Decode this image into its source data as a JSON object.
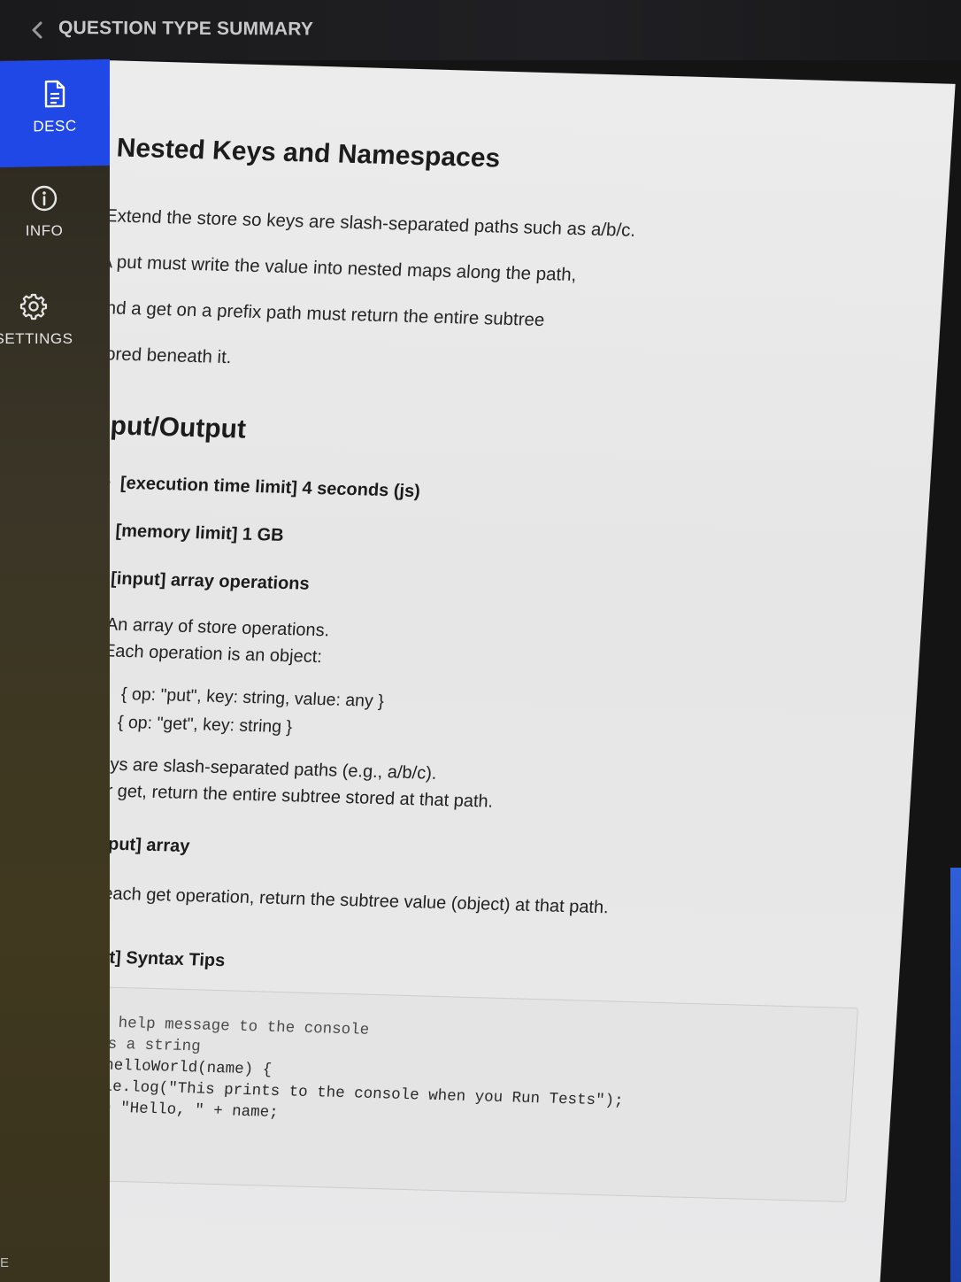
{
  "header": {
    "title": "QUESTION TYPE SUMMARY"
  },
  "sidebar": {
    "items": [
      {
        "label": "DESC",
        "icon": "document-icon",
        "active": true
      },
      {
        "label": "INFO",
        "icon": "info-icon",
        "active": false
      },
      {
        "label": "SETTINGS",
        "icon": "gear-icon",
        "active": false
      }
    ],
    "corner_letter": "E"
  },
  "colors": {
    "accent": "#1f48e6",
    "topbar": "#1c1c1e",
    "sidebar": "#3a3526",
    "content_bg": "#e9e9e9"
  },
  "main": {
    "title": "Nested Keys and Namespaces",
    "description": [
      "Extend the store so keys are slash-separated paths such as a/b/c.",
      "A put must write the value into nested maps along the path,",
      "and a get on a prefix path must return the entire subtree",
      "stored beneath it."
    ],
    "io_heading": "Input/Output",
    "limits": [
      "[execution time limit] 4 seconds (js)",
      "[memory limit] 1 GB"
    ],
    "input": {
      "label": "[input] array operations",
      "desc_line1": "An array of store operations.",
      "desc_line2": "Each operation is an object:",
      "shapes": [
        "{ op: \"put\", key: string, value: any }",
        "{ op: \"get\", key: string }"
      ],
      "note_line1": "Keys are slash-separated paths (e.g., a/b/c).",
      "note_line2": "For get, return the entire subtree stored at that path."
    },
    "output": {
      "label": "[output] array",
      "desc": "For each get operation, return the subtree value (object) at that path."
    },
    "tips_heading": "[JavaScript] Syntax Tips",
    "code_lines": [
      "// Prints help message to the console",
      "// Returns a string",
      "function helloWorld(name) {",
      "    console.log(\"This prints to the console when you Run Tests\");",
      "    return \"Hello, \" + name;",
      "}"
    ]
  }
}
